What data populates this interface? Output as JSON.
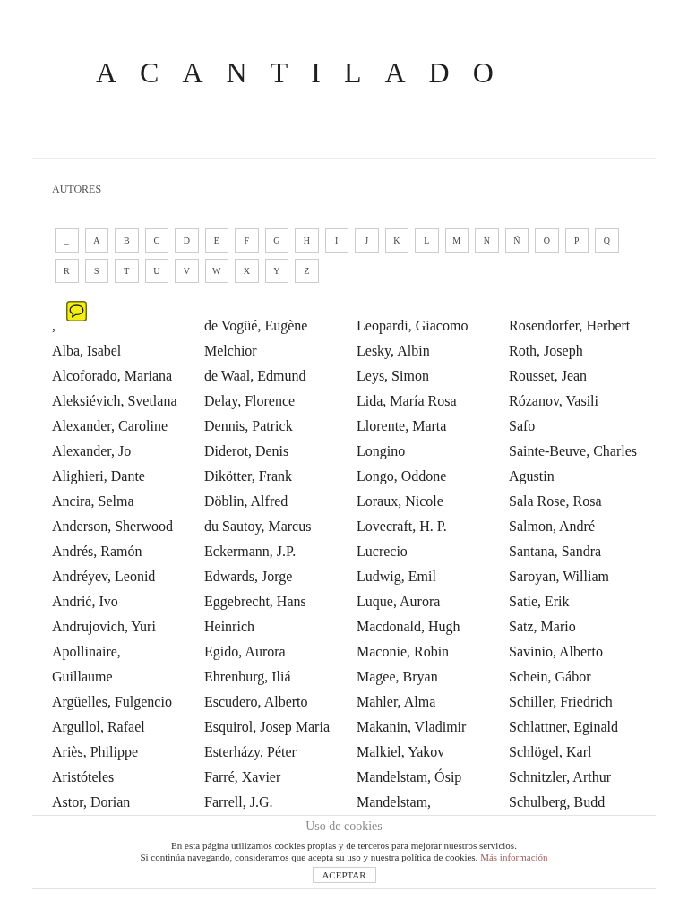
{
  "header": {
    "logo": "ACANTILADO"
  },
  "section": {
    "title": "AUTORES"
  },
  "letters": [
    "_",
    "A",
    "B",
    "C",
    "D",
    "E",
    "F",
    "G",
    "H",
    "I",
    "J",
    "K",
    "L",
    "M",
    "N",
    "Ñ",
    "O",
    "P",
    "Q",
    "R",
    "S",
    "T",
    "U",
    "V",
    "W",
    "X",
    "Y",
    "Z"
  ],
  "authors": {
    "columns": [
      [
        ",",
        "Alba, Isabel",
        "Alcoforado, Mariana",
        "Aleksiévich, Svetlana",
        "Alexander, Caroline",
        "Alexander, Jo",
        "Alighieri, Dante",
        "Ancira, Selma",
        "Anderson, Sherwood",
        "Andrés, Ramón",
        "Andréyev, Leonid",
        "Andrić, Ivo",
        "Andrujovich, Yuri",
        "Apollinaire, Guillaume",
        "Argüelles, Fulgencio",
        "Argullol, Rafael",
        "Ariès, Philippe",
        "Aristóteles",
        "Astor, Dorian"
      ],
      [
        "de Vogüé, Eugène Melchior",
        "de Waal, Edmund",
        "Delay, Florence",
        "Dennis, Patrick",
        "Diderot, Denis",
        "Dikötter, Frank",
        "Döblin, Alfred",
        "du Sautoy, Marcus",
        "Eckermann, J.P.",
        "Edwards, Jorge",
        "Eggebrecht, Hans Heinrich",
        "Egido, Aurora",
        "Ehrenburg, Iliá",
        "Escudero, Alberto",
        "Esquirol, Josep Maria",
        "Esterházy, Péter",
        "Farré, Xavier",
        "Farrell, J.G."
      ],
      [
        "Leopardi, Giacomo",
        "Lesky, Albin",
        "Leys, Simon",
        "Lida, María Rosa",
        "Llorente, Marta",
        "Longino",
        "Longo, Oddone",
        "Loraux, Nicole",
        "Lovecraft, H. P.",
        "Lucrecio",
        "Ludwig, Emil",
        "Luque, Aurora",
        "Macdonald, Hugh",
        "Maconie, Robin",
        "Magee, Bryan",
        "Mahler, Alma",
        "Makanin, Vladimir",
        "Malkiel, Yakov",
        "Mandelstam, Ósip",
        "Mandelstam,"
      ],
      [
        "Rosendorfer, Herbert",
        "Roth, Joseph",
        "Rousset, Jean",
        "Rózanov, Vasili",
        "Safo",
        "Sainte-Beuve, Charles Agustin",
        "Sala Rose, Rosa",
        "Salmon, André",
        "Santana, Sandra",
        "Saroyan, William",
        "Satie, Erik",
        "Satz, Mario",
        "Savinio, Alberto",
        "Schein, Gábor",
        "Schiller, Friedrich",
        "Schlattner, Eginald",
        "Schlögel, Karl",
        "Schnitzler, Arthur",
        "Schulberg, Budd"
      ]
    ]
  },
  "cookie_banner": {
    "title": "Uso de cookies",
    "lines": [
      "En esta página utilizamos cookies propias y de terceros para mejorar nuestros servicios.",
      "Si continúa navegando, consideramos que acepta su uso y nuestra política de cookies."
    ],
    "link": "Más información",
    "button": "ACEPTAR"
  }
}
